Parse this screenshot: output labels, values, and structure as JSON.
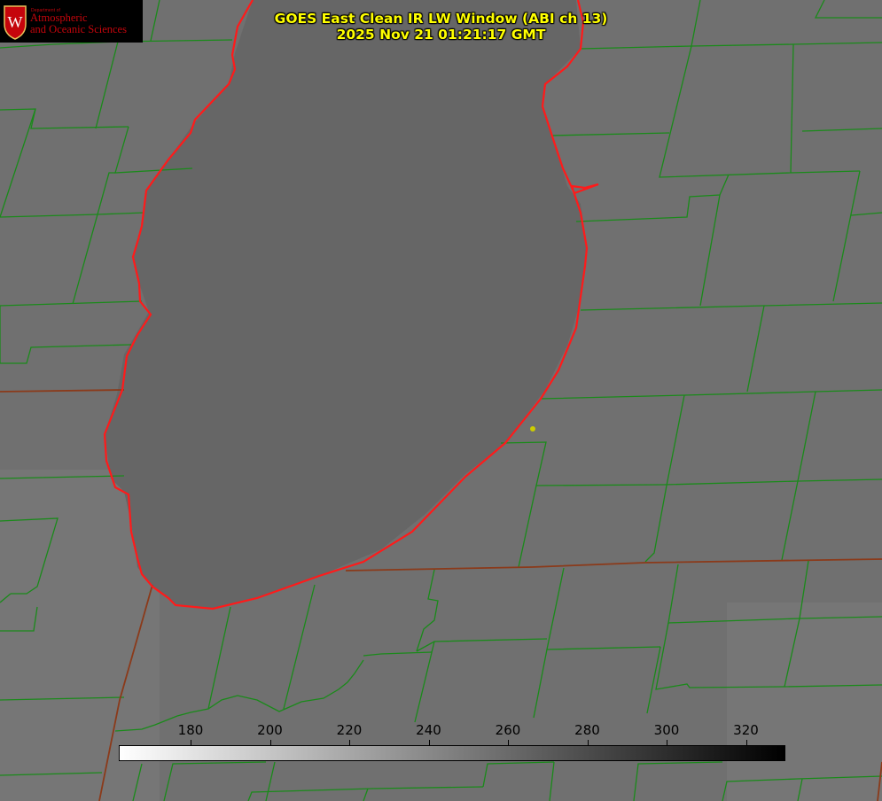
{
  "logo": {
    "department": "Department of",
    "line1": "Atmospheric",
    "line2": "and Oceanic Sciences"
  },
  "title": {
    "line1": "GOES East Clean IR LW Window (ABI ch 13)",
    "line2": "2025 Nov 21 01:21:17 GMT"
  },
  "colorbar": {
    "ticks": [
      "180",
      "200",
      "220",
      "240",
      "260",
      "280",
      "300",
      "320"
    ],
    "colors": {
      "low": "#ffffff",
      "high": "#000000"
    }
  },
  "map": {
    "background_color": "#6f6f6f",
    "lake_color": "#666666",
    "county_line_color": "#1a8a1a",
    "state_line_color": "#8b3a1a",
    "coastline_color": "#ff1a1a",
    "marker_color": "#cccc00",
    "marker": "site-marker"
  }
}
